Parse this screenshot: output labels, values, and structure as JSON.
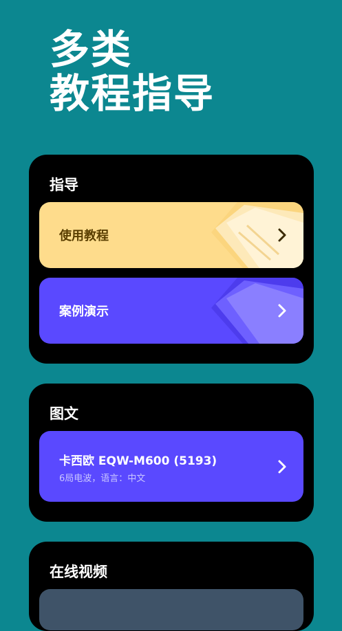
{
  "hero": {
    "line1": "多类",
    "line2": "教程指导"
  },
  "guide": {
    "title": "指导",
    "items": [
      {
        "label": "使用教程"
      },
      {
        "label": "案例演示"
      }
    ]
  },
  "graphic": {
    "title": "图文",
    "item": {
      "title": "卡西欧 EQW-M600 (5193)",
      "subtitle": "6局电波，语言：中文"
    }
  },
  "video": {
    "title": "在线视频"
  },
  "colors": {
    "background": "#0c8790",
    "card": "#000000",
    "yellow_tile": "#fedc8c",
    "purple_tile": "#5a49ff",
    "video_tile": "#3f5368"
  }
}
